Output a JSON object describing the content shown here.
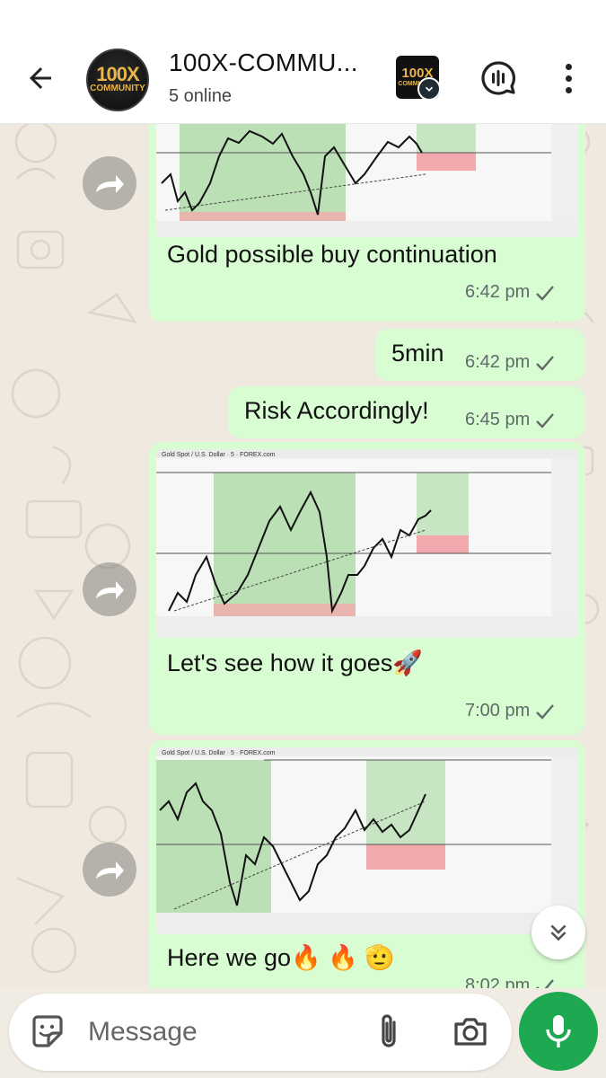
{
  "header": {
    "title": "100X-COMMU...",
    "subtitle": "5 online",
    "avatar_text_top": "100X",
    "avatar_text_bottom": "COMMUNITY"
  },
  "colors": {
    "bubble_outgoing": "#d9fdd3",
    "accent_green": "#1da851",
    "chart_green_zone": "#a8d8a0",
    "chart_red_zone": "#f2a9ad"
  },
  "messages": [
    {
      "type": "image_caption",
      "caption": "Gold possible buy continuation",
      "time": "6:42 pm",
      "status": "sent"
    },
    {
      "type": "text",
      "text": "5min",
      "time": "6:42 pm",
      "status": "sent"
    },
    {
      "type": "text",
      "text": "Risk Accordingly!",
      "time": "6:45 pm",
      "status": "sent"
    },
    {
      "type": "image_caption",
      "chart_title": "Gold Spot / U.S. Dollar · 5 · FOREX.com",
      "caption": "Let's see how it goes🚀",
      "time": "7:00 pm",
      "status": "sent"
    },
    {
      "type": "image_caption",
      "chart_title": "Gold Spot / U.S. Dollar · 5 · FOREX.com",
      "caption": "Here we go🔥 🔥 🫡",
      "time": "8:02 pm",
      "status": "sent"
    }
  ],
  "composer": {
    "placeholder": "Message"
  },
  "icons": {
    "back": "arrow-left-icon",
    "call": "voice-chat-icon",
    "menu": "more-vertical-icon",
    "forward": "forward-icon",
    "sticker": "sticker-icon",
    "attach": "paperclip-icon",
    "camera": "camera-icon",
    "mic": "mic-icon",
    "scroll": "double-chevron-down-icon",
    "check": "check-icon"
  }
}
